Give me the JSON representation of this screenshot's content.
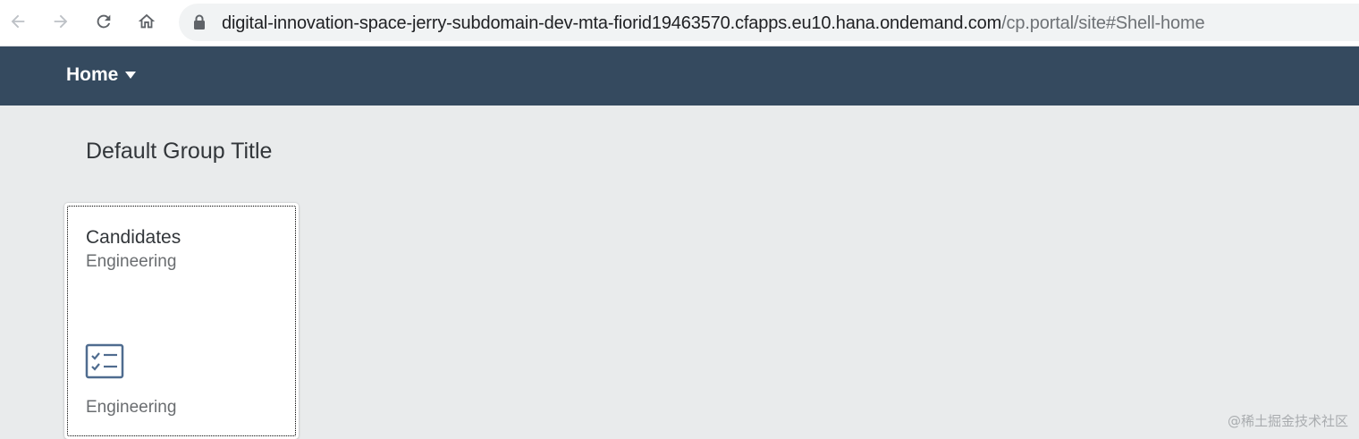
{
  "browser": {
    "url_host": "digital-innovation-space-jerry-subdomain-dev-mta-fiorid19463570.cfapps.eu10.hana.ondemand.com",
    "url_path": "/cp.portal/site#Shell-home",
    "icons": [
      "back-arrow-icon",
      "forward-arrow-icon",
      "reload-icon",
      "home-icon",
      "lock-icon"
    ]
  },
  "shell": {
    "home_label": "Home",
    "header_color": "#354a5f"
  },
  "content": {
    "group_title": "Default Group Title",
    "tiles": [
      {
        "title": "Candidates",
        "subtitle": "Engineering",
        "icon": "checklist-icon",
        "footer": "Engineering"
      }
    ]
  },
  "watermark": "@稀土掘金技术社区"
}
